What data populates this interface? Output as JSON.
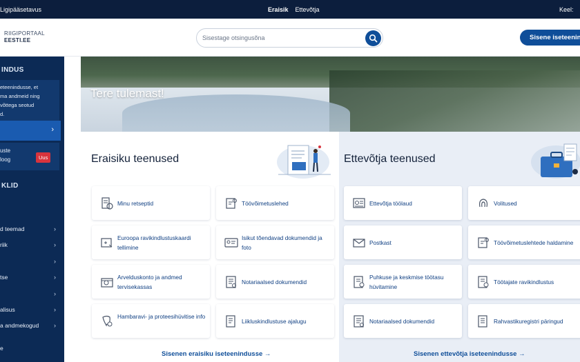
{
  "topbar": {
    "accessibility": "Ligipääsetavus",
    "tabs": [
      {
        "label": "Eraisik",
        "active": true
      },
      {
        "label": "Ettevõtja",
        "active": false
      }
    ],
    "language_label": "Keel:"
  },
  "header": {
    "logo_line1": "RIIGIPORTAAL",
    "logo_line2": "EESTI.EE",
    "search_placeholder": "Sisestage otsingusõna",
    "login_label": "Sisene iseteenindusse"
  },
  "sidebar": {
    "title": "INDUS",
    "info_lines": [
      "eteenindusse, et",
      "ma andmeid ning",
      "võttega seotud",
      "d."
    ],
    "box2_lines": [
      "uste",
      "loog"
    ],
    "new_badge": "Uus",
    "title2": "KLID",
    "items": [
      "d teemad",
      "riik",
      "",
      "tse",
      "",
      "alisus",
      "a andmekogud"
    ],
    "bottom_item": "e"
  },
  "hero": {
    "welcome": "Tere tulemast!"
  },
  "private_services": {
    "title": "Eraisiku teenused",
    "cards": [
      {
        "label": "Minu retseptid",
        "icon": "prescription-icon"
      },
      {
        "label": "Töövõimetuslehed",
        "icon": "sick-leave-icon"
      },
      {
        "label": "Euroopa ravikindlustuskaardi tellimine",
        "icon": "health-card-icon"
      },
      {
        "label": "Isikut tõendavad dokumendid ja foto",
        "icon": "id-card-icon"
      },
      {
        "label": "Arvelduskonto ja andmed tervisekassas",
        "icon": "bank-account-icon"
      },
      {
        "label": "Notariaalsed dokumendid",
        "icon": "notary-document-icon"
      },
      {
        "label": "Hambaravi- ja proteesihüvitise info",
        "icon": "tooth-icon"
      },
      {
        "label": "Liikluskindlustuse ajalugu",
        "icon": "insurance-history-icon"
      }
    ],
    "more_link": "Sisenen eraisiku iseteenindusse"
  },
  "business_services": {
    "title": "Ettevõtja teenused",
    "cards": [
      {
        "label": "Ettevõtja töölaud",
        "icon": "dashboard-icon"
      },
      {
        "label": "Volitused",
        "icon": "fingerprint-icon"
      },
      {
        "label": "Postkast",
        "icon": "mailbox-icon"
      },
      {
        "label": "Töövõimetuslehtede haldamine",
        "icon": "sick-leave-management-icon"
      },
      {
        "label": "Puhkuse ja keskmise töötasu hüvitamine",
        "icon": "vacation-pay-icon"
      },
      {
        "label": "Töötajate ravikindlustus",
        "icon": "employee-insurance-icon"
      },
      {
        "label": "Notariaalsed dokumendid",
        "icon": "notary-document-icon"
      },
      {
        "label": "Rahvastikuregistri päringud",
        "icon": "population-register-icon"
      }
    ],
    "more_link": "Sisenen ettevõtja iseteenindusse"
  },
  "colors": {
    "primary": "#0f4e99",
    "topbar": "#0c1e3d",
    "sidebar": "#0c2a55",
    "badge": "#d8343d"
  }
}
